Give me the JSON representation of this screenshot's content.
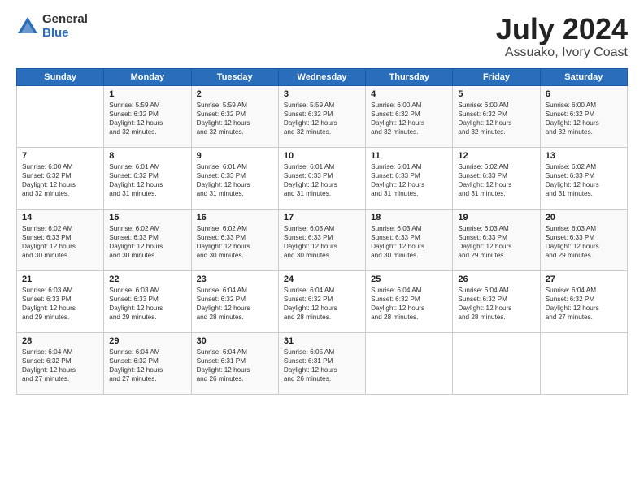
{
  "logo": {
    "general": "General",
    "blue": "Blue"
  },
  "title": "July 2024",
  "subtitle": "Assuako, Ivory Coast",
  "headers": [
    "Sunday",
    "Monday",
    "Tuesday",
    "Wednesday",
    "Thursday",
    "Friday",
    "Saturday"
  ],
  "weeks": [
    [
      {
        "day": "",
        "info": ""
      },
      {
        "day": "1",
        "info": "Sunrise: 5:59 AM\nSunset: 6:32 PM\nDaylight: 12 hours\nand 32 minutes."
      },
      {
        "day": "2",
        "info": "Sunrise: 5:59 AM\nSunset: 6:32 PM\nDaylight: 12 hours\nand 32 minutes."
      },
      {
        "day": "3",
        "info": "Sunrise: 5:59 AM\nSunset: 6:32 PM\nDaylight: 12 hours\nand 32 minutes."
      },
      {
        "day": "4",
        "info": "Sunrise: 6:00 AM\nSunset: 6:32 PM\nDaylight: 12 hours\nand 32 minutes."
      },
      {
        "day": "5",
        "info": "Sunrise: 6:00 AM\nSunset: 6:32 PM\nDaylight: 12 hours\nand 32 minutes."
      },
      {
        "day": "6",
        "info": "Sunrise: 6:00 AM\nSunset: 6:32 PM\nDaylight: 12 hours\nand 32 minutes."
      }
    ],
    [
      {
        "day": "7",
        "info": "Sunrise: 6:00 AM\nSunset: 6:32 PM\nDaylight: 12 hours\nand 32 minutes."
      },
      {
        "day": "8",
        "info": "Sunrise: 6:01 AM\nSunset: 6:32 PM\nDaylight: 12 hours\nand 31 minutes."
      },
      {
        "day": "9",
        "info": "Sunrise: 6:01 AM\nSunset: 6:33 PM\nDaylight: 12 hours\nand 31 minutes."
      },
      {
        "day": "10",
        "info": "Sunrise: 6:01 AM\nSunset: 6:33 PM\nDaylight: 12 hours\nand 31 minutes."
      },
      {
        "day": "11",
        "info": "Sunrise: 6:01 AM\nSunset: 6:33 PM\nDaylight: 12 hours\nand 31 minutes."
      },
      {
        "day": "12",
        "info": "Sunrise: 6:02 AM\nSunset: 6:33 PM\nDaylight: 12 hours\nand 31 minutes."
      },
      {
        "day": "13",
        "info": "Sunrise: 6:02 AM\nSunset: 6:33 PM\nDaylight: 12 hours\nand 31 minutes."
      }
    ],
    [
      {
        "day": "14",
        "info": "Sunrise: 6:02 AM\nSunset: 6:33 PM\nDaylight: 12 hours\nand 30 minutes."
      },
      {
        "day": "15",
        "info": "Sunrise: 6:02 AM\nSunset: 6:33 PM\nDaylight: 12 hours\nand 30 minutes."
      },
      {
        "day": "16",
        "info": "Sunrise: 6:02 AM\nSunset: 6:33 PM\nDaylight: 12 hours\nand 30 minutes."
      },
      {
        "day": "17",
        "info": "Sunrise: 6:03 AM\nSunset: 6:33 PM\nDaylight: 12 hours\nand 30 minutes."
      },
      {
        "day": "18",
        "info": "Sunrise: 6:03 AM\nSunset: 6:33 PM\nDaylight: 12 hours\nand 30 minutes."
      },
      {
        "day": "19",
        "info": "Sunrise: 6:03 AM\nSunset: 6:33 PM\nDaylight: 12 hours\nand 29 minutes."
      },
      {
        "day": "20",
        "info": "Sunrise: 6:03 AM\nSunset: 6:33 PM\nDaylight: 12 hours\nand 29 minutes."
      }
    ],
    [
      {
        "day": "21",
        "info": "Sunrise: 6:03 AM\nSunset: 6:33 PM\nDaylight: 12 hours\nand 29 minutes."
      },
      {
        "day": "22",
        "info": "Sunrise: 6:03 AM\nSunset: 6:33 PM\nDaylight: 12 hours\nand 29 minutes."
      },
      {
        "day": "23",
        "info": "Sunrise: 6:04 AM\nSunset: 6:32 PM\nDaylight: 12 hours\nand 28 minutes."
      },
      {
        "day": "24",
        "info": "Sunrise: 6:04 AM\nSunset: 6:32 PM\nDaylight: 12 hours\nand 28 minutes."
      },
      {
        "day": "25",
        "info": "Sunrise: 6:04 AM\nSunset: 6:32 PM\nDaylight: 12 hours\nand 28 minutes."
      },
      {
        "day": "26",
        "info": "Sunrise: 6:04 AM\nSunset: 6:32 PM\nDaylight: 12 hours\nand 28 minutes."
      },
      {
        "day": "27",
        "info": "Sunrise: 6:04 AM\nSunset: 6:32 PM\nDaylight: 12 hours\nand 27 minutes."
      }
    ],
    [
      {
        "day": "28",
        "info": "Sunrise: 6:04 AM\nSunset: 6:32 PM\nDaylight: 12 hours\nand 27 minutes."
      },
      {
        "day": "29",
        "info": "Sunrise: 6:04 AM\nSunset: 6:32 PM\nDaylight: 12 hours\nand 27 minutes."
      },
      {
        "day": "30",
        "info": "Sunrise: 6:04 AM\nSunset: 6:31 PM\nDaylight: 12 hours\nand 26 minutes."
      },
      {
        "day": "31",
        "info": "Sunrise: 6:05 AM\nSunset: 6:31 PM\nDaylight: 12 hours\nand 26 minutes."
      },
      {
        "day": "",
        "info": ""
      },
      {
        "day": "",
        "info": ""
      },
      {
        "day": "",
        "info": ""
      }
    ]
  ]
}
